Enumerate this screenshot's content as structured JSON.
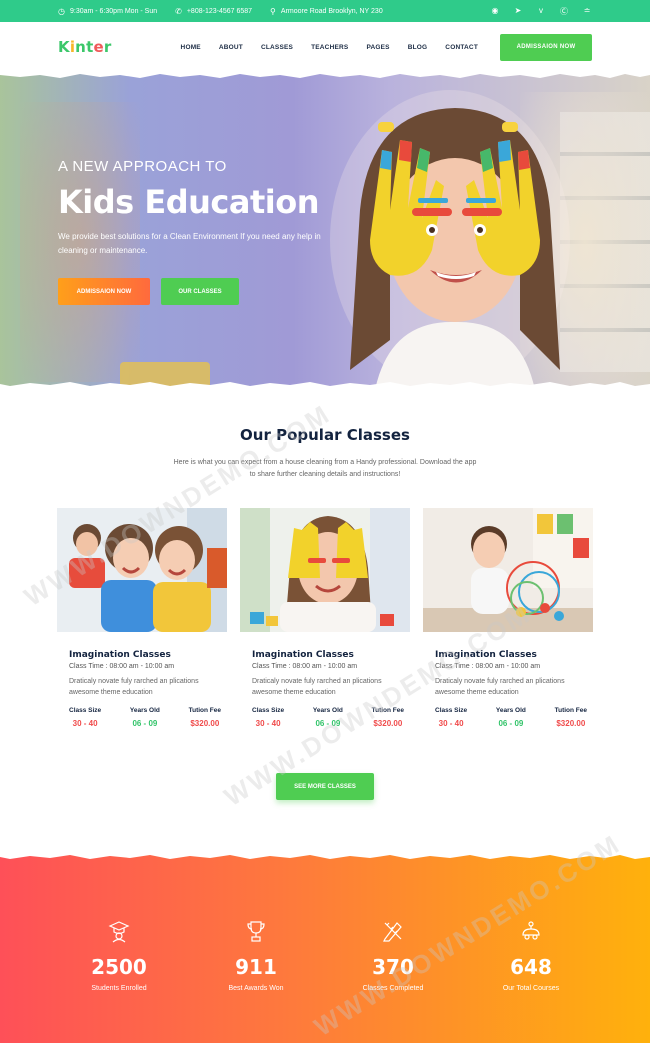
{
  "topbar": {
    "hours": "9:30am - 6:30pm Mon - Sun",
    "phone": "+808-123-4567 6587",
    "address": "Armoore Road Brooklyn, NY 230",
    "socials": [
      "dribbble-icon",
      "twitter-icon",
      "vimeo-icon",
      "skype-icon",
      "rss-icon"
    ]
  },
  "header": {
    "logo_letters": [
      "K",
      "i",
      "n",
      "t",
      "e",
      "r"
    ],
    "nav": [
      "HOME",
      "ABOUT",
      "CLASSES",
      "TEACHERS",
      "PAGES",
      "BLOG",
      "CONTACT"
    ],
    "cta": "ADMISSAION NOW"
  },
  "hero": {
    "tagline": "A NEW APPROACH TO",
    "headline": "Kids Education",
    "description": "We provide best solutions for a Clean Environment If you need any help in cleaning or maintenance.",
    "btn_admission": "ADMISSAION NOW",
    "btn_classes": "OUR CLASSES"
  },
  "classes": {
    "title": "Our Popular Classes",
    "subtitle": "Here is what you can expect from a house cleaning from a Handy professional. Download the app to share further cleaning details and instructions!",
    "items": [
      {
        "title": "Imagination Classes",
        "time": "Class Time : 08:00 am - 10:00 am",
        "text": "Draticaly novate fuly rarched an plications awesome theme education",
        "size_label": "Class Size",
        "size": "30 - 40",
        "years_label": "Years Old",
        "years": "06 - 09",
        "fee_label": "Tution Fee",
        "fee": "$320.00"
      },
      {
        "title": "Imagination Classes",
        "time": "Class Time : 08:00 am - 10:00 am",
        "text": "Draticaly novate fuly rarched an plications awesome theme education",
        "size_label": "Class Size",
        "size": "30 - 40",
        "years_label": "Years Old",
        "years": "06 - 09",
        "fee_label": "Tution Fee",
        "fee": "$320.00"
      },
      {
        "title": "Imagination Classes",
        "time": "Class Time : 08:00 am - 10:00 am",
        "text": "Draticaly novate fuly rarched an plications awesome theme education",
        "size_label": "Class Size",
        "size": "30 - 40",
        "years_label": "Years Old",
        "years": "06 - 09",
        "fee_label": "Tution Fee",
        "fee": "$320.00"
      }
    ],
    "more": "SEE MORE CLASSES"
  },
  "counters": [
    {
      "icon": "graduate-icon",
      "number": "2500",
      "label": "Students Enrolled"
    },
    {
      "icon": "trophy-icon",
      "number": "911",
      "label": "Best Awards Won"
    },
    {
      "icon": "pencil-ruler-icon",
      "number": "370",
      "label": "Classes Completed"
    },
    {
      "icon": "toy-car-icon",
      "number": "648",
      "label": "Our Total Courses"
    }
  ],
  "watermark": "WWW.DOWNDEMO.COM",
  "colors": {
    "topbar": "#2fcb8a",
    "accent_green": "#4fcd52",
    "accent_orange": "#ff8a2b",
    "price_red": "#f04b4b",
    "age_green": "#33c46a",
    "navy": "#13233f"
  }
}
